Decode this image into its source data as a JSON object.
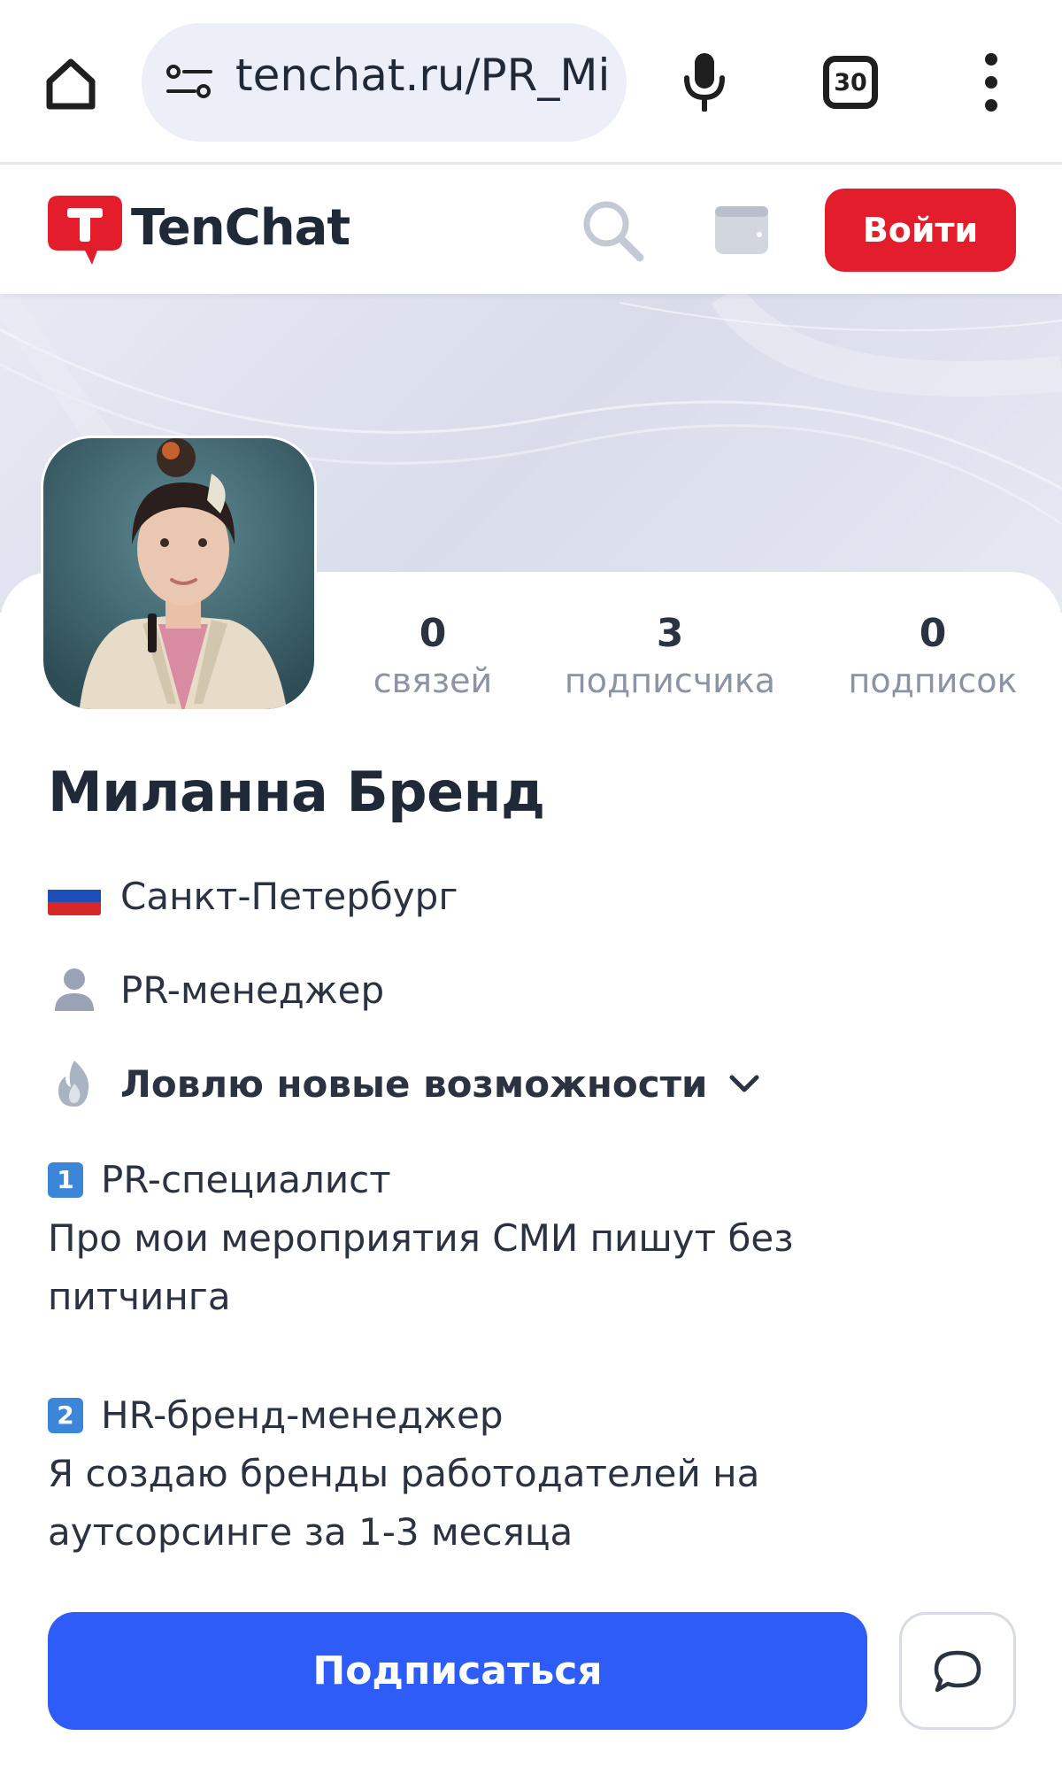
{
  "browser": {
    "url": "tenchat.ru/PR_Mi",
    "tab_count": "30",
    "icons": [
      "home-icon",
      "site-settings-icon",
      "mic-icon",
      "tabs-icon",
      "more-vert-icon"
    ]
  },
  "header": {
    "logo_text": "TenChat",
    "login_label": "Войти",
    "icons": [
      "tenchat-logo-icon",
      "search-icon",
      "wallet-icon"
    ],
    "colors": {
      "brand_red": "#e31d2b"
    }
  },
  "profile": {
    "name": "Миланна Бренд",
    "stats": [
      {
        "value": "0",
        "label": "связей"
      },
      {
        "value": "3",
        "label": "подписчика"
      },
      {
        "value": "0",
        "label": "подписок"
      }
    ],
    "city": "Санкт-Петербург",
    "position": "PR-менеджер",
    "status": "Ловлю новые возможности",
    "about": [
      {
        "badge": "1",
        "title": "PR-специалист",
        "lines": [
          "Про мои мероприятия СМИ пишут без",
          "питчинга"
        ]
      },
      {
        "badge": "2",
        "title": "HR-бренд-менеджер",
        "lines": [
          "Я создаю бренды работодателей на",
          "аутсорсинге за 1-3 месяца"
        ]
      }
    ]
  },
  "actions": {
    "subscribe_label": "Подписаться",
    "colors": {
      "primary_blue": "#2e5cf6"
    }
  }
}
